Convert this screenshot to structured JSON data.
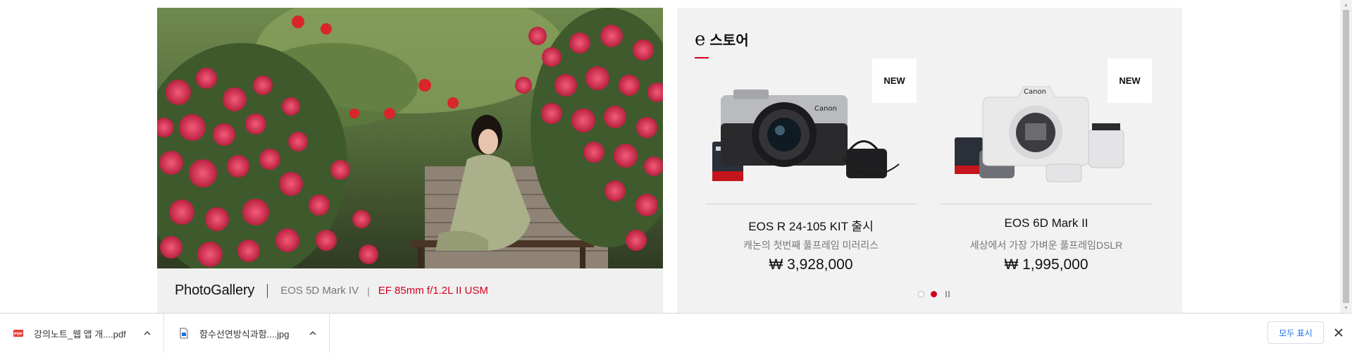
{
  "gallery": {
    "title": "PhotoGallery",
    "camera": "EOS 5D Mark IV",
    "separator": "|",
    "lens": "EF 85mm f/1.2L II USM"
  },
  "estore": {
    "title_e": "e",
    "title_label": "스토어",
    "accent_color": "#d1001f",
    "products": [
      {
        "badge": "NEW",
        "name": "EOS R 24-105 KIT 출시",
        "description": "캐논의 첫번째 풀프레임 미러리스",
        "price": "₩ 3,928,000",
        "image_icon": "camera-kit-black"
      },
      {
        "badge": "NEW",
        "name": "EOS 6D Mark II",
        "description": "세상에서 가장 가벼운 풀프레임DSLR",
        "price": "₩ 1,995,000",
        "image_icon": "camera-kit-white"
      }
    ],
    "pager": {
      "total_dots": 2,
      "active_index": 1,
      "control_icon": "pause-icon"
    }
  },
  "downloads": {
    "items": [
      {
        "name": "강의노트_웹 앱 개....pdf",
        "icon": "pdf-file-icon"
      },
      {
        "name": "함수선연방식과함....jpg",
        "icon": "image-file-icon"
      }
    ],
    "show_all_label": "모두 표시",
    "link_color": "#1a73e8"
  }
}
